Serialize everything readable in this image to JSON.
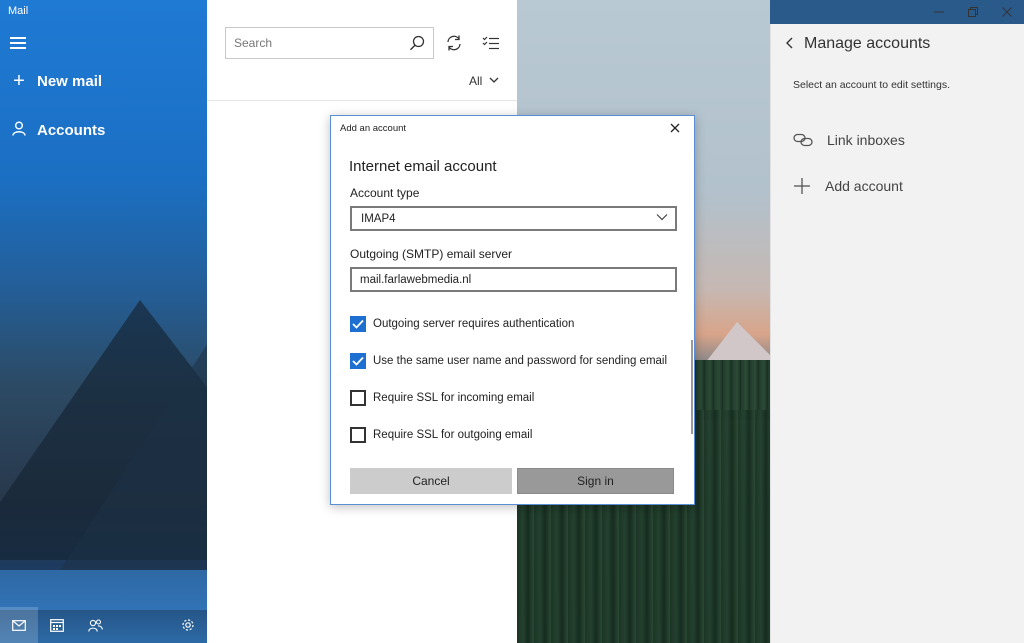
{
  "app": {
    "title": "Mail"
  },
  "nav": {
    "new_mail": "New mail",
    "accounts": "Accounts",
    "bottom_icons": [
      "mail-icon",
      "calendar-icon",
      "people-icon",
      "settings-icon"
    ]
  },
  "list": {
    "search_placeholder": "Search",
    "filter_label": "All"
  },
  "settings": {
    "title": "Manage accounts",
    "subtitle": "Select an account to edit settings.",
    "link_inboxes": "Link inboxes",
    "add_account": "Add account"
  },
  "dialog": {
    "caption": "Add an account",
    "heading": "Internet email account",
    "account_type_label": "Account type",
    "account_type_value": "IMAP4",
    "smtp_label": "Outgoing (SMTP) email server",
    "smtp_value": "mail.farlawebmedia.nl",
    "checkboxes": [
      {
        "label": "Outgoing server requires authentication",
        "checked": true
      },
      {
        "label": "Use the same user name and password for sending email",
        "checked": true
      },
      {
        "label": "Require SSL for incoming email",
        "checked": false
      },
      {
        "label": "Require SSL for outgoing email",
        "checked": false
      }
    ],
    "cancel_label": "Cancel",
    "signin_label": "Sign in"
  },
  "colors": {
    "accent": "#1e6fd2",
    "nav_blue": "#1f7ad4",
    "settings_bg": "#f2f2f2"
  }
}
